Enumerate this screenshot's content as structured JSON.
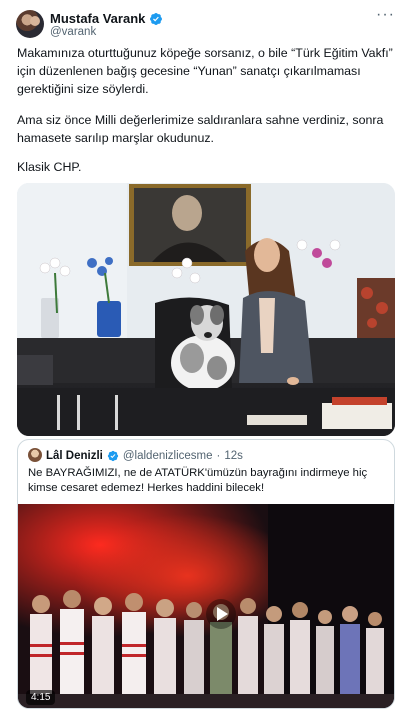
{
  "author": {
    "display_name": "Mustafa Varank",
    "handle": "@varank"
  },
  "more_icon": "more-horizontal-icon",
  "verified_color": "#1d9bf0",
  "tweet": {
    "paragraph1": "Makamınıza oturttuğunuz köpeğe sorsanız, o bile “Türk Eğitim Vakfı” için düzenlenen bağış gecesine “Yunan” sanatçı çıkarılmaması gerektiğini size söylerdi.",
    "paragraph2": "Ama siz önce Milli değerlerimize saldıranlara sahne verdiniz, sonra hamasete sarılıp marşlar okudunuz.",
    "paragraph3": "Klasik CHP."
  },
  "quote": {
    "display_name": "Lâl Denizli",
    "handle": "@laldenizlicesme",
    "separator": "·",
    "time": "12s",
    "text": "Ne BAYRAĞIMIZI, ne de ATATÜRK'ümüzün bayrağını indirmeye hiç kimse cesaret edemez! Herkes haddini bilecek!",
    "video_duration": "4:15"
  }
}
